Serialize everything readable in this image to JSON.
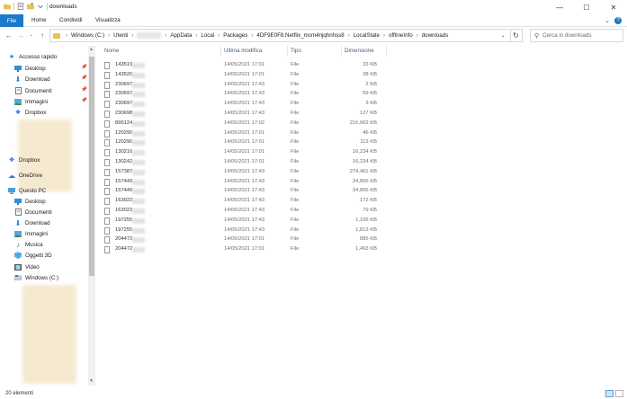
{
  "window": {
    "title": "downloads",
    "minimize_glyph": "—",
    "maximize_glyph": "☐",
    "close_glyph": "✕"
  },
  "ribbon": {
    "file_tab": "File",
    "tabs": [
      "Home",
      "Condividi",
      "Visualizza"
    ],
    "expand_glyph": "⌄",
    "help_glyph": "?"
  },
  "address": {
    "segments": [
      "Windows (C:)",
      "Utenti",
      "AppData",
      "Local",
      "Packages",
      "4DF9E0F8.Netflix_mcm4njqhnhss8",
      "LocalState",
      "offlineInfo",
      "downloads"
    ],
    "separator": "›",
    "search_placeholder": "Cerca in downloads"
  },
  "nav_pane": {
    "quick_access": "Accesso rapido",
    "quick_items": [
      "Desktop",
      "Download",
      "Documenti",
      "Immagini",
      "Dropbox"
    ],
    "dropbox": "Dropbox",
    "onedrive": "OneDrive",
    "this_pc": "Questo PC",
    "pc_items": [
      "Desktop",
      "Documenti",
      "Download",
      "Immagini",
      "Musica",
      "Oggetti 3D",
      "Video",
      "Windows (C:)"
    ]
  },
  "columns": {
    "name": "Nome",
    "modified": "Ultima modifica",
    "type": "Tipo",
    "size": "Dimensione"
  },
  "files": [
    {
      "name": "143519",
      "date": "14/05/2021 17:01",
      "type": "File",
      "size": "33 KB"
    },
    {
      "name": "143520",
      "date": "14/05/2021 17:01",
      "type": "File",
      "size": "38 KB"
    },
    {
      "name": "230697",
      "date": "14/05/2021 17:43",
      "type": "File",
      "size": "2 KB"
    },
    {
      "name": "230697",
      "date": "14/05/2021 17:43",
      "type": "File",
      "size": "59 KB"
    },
    {
      "name": "230697",
      "date": "14/05/2021 17:43",
      "type": "File",
      "size": "3 KB"
    },
    {
      "name": "230698",
      "date": "14/05/2021 17:43",
      "type": "File",
      "size": "127 KB"
    },
    {
      "name": "895124",
      "date": "14/05/2021 17:02",
      "type": "File",
      "size": "216,962 KB"
    },
    {
      "name": "120290",
      "date": "14/05/2021 17:01",
      "type": "File",
      "size": "46 KB"
    },
    {
      "name": "120290",
      "date": "14/05/2021 17:01",
      "type": "File",
      "size": "113 KB"
    },
    {
      "name": "130216",
      "date": "14/05/2021 17:01",
      "type": "File",
      "size": "16,234 KB"
    },
    {
      "name": "130242",
      "date": "14/05/2021 17:01",
      "type": "File",
      "size": "16,234 KB"
    },
    {
      "name": "157387",
      "date": "14/05/2021 17:43",
      "type": "File",
      "size": "274,461 KB"
    },
    {
      "name": "157449",
      "date": "14/05/2021 17:43",
      "type": "File",
      "size": "34,866 KB"
    },
    {
      "name": "157449",
      "date": "14/05/2021 17:43",
      "type": "File",
      "size": "34,866 KB"
    },
    {
      "name": "163023",
      "date": "14/05/2021 17:43",
      "type": "File",
      "size": "172 KB"
    },
    {
      "name": "163023",
      "date": "14/05/2021 17:43",
      "type": "File",
      "size": "79 KB"
    },
    {
      "name": "197255",
      "date": "14/05/2021 17:43",
      "type": "File",
      "size": "1,106 KB"
    },
    {
      "name": "197255",
      "date": "14/05/2021 17:43",
      "type": "File",
      "size": "1,813 KB"
    },
    {
      "name": "204472",
      "date": "14/05/2021 17:01",
      "type": "File",
      "size": "886 KB"
    },
    {
      "name": "204472",
      "date": "14/05/2021 17:01",
      "type": "File",
      "size": "1,493 KB"
    }
  ],
  "status": {
    "count": "20 elementi"
  },
  "colors": {
    "file_tab": "#1979ca",
    "folder": "#e8c24f",
    "header_text": "#4c607a"
  }
}
